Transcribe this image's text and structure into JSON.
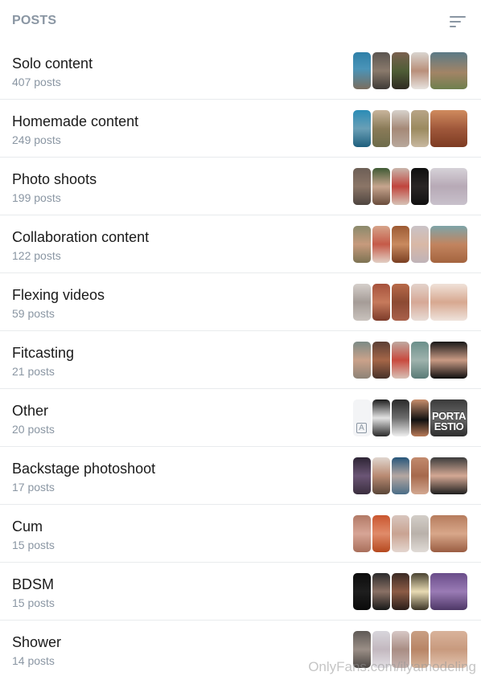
{
  "header": {
    "title": "POSTS",
    "sort_icon": "sort-lines-icon"
  },
  "categories": [
    {
      "name": "Solo content",
      "count": "407 posts",
      "thumbs": [
        {
          "bg": "linear-gradient(180deg,#2e7fa8 0%,#4b94b8 45%,#7a6d5e 100%)"
        },
        {
          "bg": "linear-gradient(180deg,#5b5550 0%,#8a7a6c 50%,#3e3a36 100%)"
        },
        {
          "bg": "linear-gradient(180deg,#7a6150 0%,#4f5d36 50%,#2f2b22 100%)"
        },
        {
          "bg": "linear-gradient(180deg,#d9d4cf 0%,#b98f7a 50%,#e7e3df 100%)"
        },
        {
          "bg": "linear-gradient(180deg,#5b7a86 0%,#a28466 55%,#6e7f4d 100%)"
        }
      ]
    },
    {
      "name": "Homemade content",
      "count": "249 posts",
      "thumbs": [
        {
          "bg": "linear-gradient(180deg,#2b8cb6 0%,#6a9fb6 50%,#1e5f7d 100%)"
        },
        {
          "bg": "linear-gradient(180deg,#c9b59c 0%,#8a7b58 50%,#6d6b4a 100%)"
        },
        {
          "bg": "linear-gradient(180deg,#d7d2cc 0%,#a58977 50%,#b8a89c 100%)"
        },
        {
          "bg": "linear-gradient(180deg,#b8a587 0%,#9b8a5f 50%,#c8b8a0 100%)"
        },
        {
          "bg": "linear-gradient(180deg,#d08b5e 0%,#a0583b 50%,#7d3b22 100%)"
        }
      ]
    },
    {
      "name": "Photo shoots",
      "count": "199 posts",
      "thumbs": [
        {
          "bg": "linear-gradient(180deg,#6d5f56 0%,#8b7567 50%,#4e4540 100%)"
        },
        {
          "bg": "linear-gradient(180deg,#3f5a34 0%,#c7a58e 50%,#6a4d3c 100%)"
        },
        {
          "bg": "linear-gradient(180deg,#c9b5ab 0%,#c0453d 50%,#d6c2b6 100%)"
        },
        {
          "bg": "linear-gradient(180deg,#0f0f0f 0%,#2a2625 50%,#111111 100%)"
        },
        {
          "bg": "linear-gradient(180deg,#d6d2d8 0%,#b7a9b6 50%,#c8c1cb 100%)"
        }
      ]
    },
    {
      "name": "Collaboration content",
      "count": "122 posts",
      "thumbs": [
        {
          "bg": "linear-gradient(180deg,#8b8a6c 0%,#c79a7c 50%,#7d7353 100%)"
        },
        {
          "bg": "linear-gradient(180deg,#d6a48a 0%,#c55a48 50%,#e2cfc4 100%)"
        },
        {
          "bg": "linear-gradient(180deg,#9c5a33 0%,#c98a5f 50%,#7a3f22 100%)"
        },
        {
          "bg": "linear-gradient(180deg,#c9c3c7 0%,#d9b8a6 50%,#bfb3b8 100%)"
        },
        {
          "bg": "linear-gradient(180deg,#7ea4a8 0%,#c2845f 50%,#a4643f 100%)"
        }
      ]
    },
    {
      "name": "Flexing videos",
      "count": "59 posts",
      "thumbs": [
        {
          "bg": "linear-gradient(180deg,#d5cfcb 0%,#a59c97 50%,#c9c2bd 100%)"
        },
        {
          "bg": "linear-gradient(180deg,#a6523c 0%,#c67a5c 50%,#7c3b2a 100%)"
        },
        {
          "bg": "linear-gradient(180deg,#b86a4a 0%,#8c4a33 50%,#a9604a 100%)"
        },
        {
          "bg": "linear-gradient(180deg,#e3d3cb 0%,#d6a896 50%,#e8dcd6 100%)"
        },
        {
          "bg": "linear-gradient(180deg,#f0e2d9 0%,#d7a890 50%,#efe3dc 100%)"
        }
      ]
    },
    {
      "name": "Fitcasting",
      "count": "21 posts",
      "thumbs": [
        {
          "bg": "linear-gradient(180deg,#7c8a86 0%,#caa28a 50%,#8d8276 100%)"
        },
        {
          "bg": "linear-gradient(180deg,#5b3f35 0%,#a56648 50%,#473129 100%)"
        },
        {
          "bg": "linear-gradient(180deg,#bfa9a0 0%,#c84a3e 50%,#d8c1b6 100%)"
        },
        {
          "bg": "linear-gradient(180deg,#6b8f8a 0%,#9fb3ad 50%,#597a76 100%)"
        },
        {
          "bg": "linear-gradient(180deg,#181818 0%,#c99a84 50%,#0f0f0f 100%)"
        }
      ]
    },
    {
      "name": "Other",
      "count": "20 posts",
      "thumbs": [
        {
          "bg": "#f3f4f6",
          "glyph": "A"
        },
        {
          "bg": "linear-gradient(180deg,#1c1c1c 0%,#e3e3e3 50%,#2a2a2a 100%)"
        },
        {
          "bg": "linear-gradient(180deg,#2a2a2a 0%,#6c6c6c 50%,#f0f0f0 100%)"
        },
        {
          "bg": "linear-gradient(180deg,#c88e6c 0%,#111111 55%,#b87a58 100%)"
        },
        {
          "bg": "linear-gradient(180deg,#3a3a3a 0%,#6a6a6a 50%,#2d2d2d 100%)",
          "text": "PORTA\nESTIO"
        }
      ]
    },
    {
      "name": "Backstage photoshoot",
      "count": "17 posts",
      "thumbs": [
        {
          "bg": "linear-gradient(180deg,#2e2535 0%,#6b5575 50%,#3a2e3e 100%)"
        },
        {
          "bg": "linear-gradient(180deg,#e0d6cf 0%,#b98a72 50%,#5a4638 100%)"
        },
        {
          "bg": "linear-gradient(180deg,#27567a 0%,#b5a7a1 50%,#4b6d87 100%)"
        },
        {
          "bg": "linear-gradient(180deg,#c28a6d 0%,#a6694d 50%,#d3a891 100%)"
        },
        {
          "bg": "linear-gradient(180deg,#3c3c3c 0%,#d4a894 50%,#1f1f1f 100%)"
        }
      ]
    },
    {
      "name": "Cum",
      "count": "15 posts",
      "thumbs": [
        {
          "bg": "linear-gradient(180deg,#b27a66 0%,#d7a596 50%,#a96f5b 100%)"
        },
        {
          "bg": "linear-gradient(180deg,#c9562f 0%,#e08b6a 50%,#b5491f 100%)"
        },
        {
          "bg": "linear-gradient(180deg,#d8c6be 0%,#c9a392 50%,#e4d6cf 100%)"
        },
        {
          "bg": "linear-gradient(180deg,#d3cec8 0%,#b9b1aa 50%,#e0dbd6 100%)"
        },
        {
          "bg": "linear-gradient(180deg,#b67c5d 0%,#d8a78a 50%,#9a5d42 100%)"
        }
      ]
    },
    {
      "name": "BDSM",
      "count": "15 posts",
      "thumbs": [
        {
          "bg": "linear-gradient(180deg,#0c0c0c 0%,#1e1e1e 50%,#0a0a0a 100%)"
        },
        {
          "bg": "linear-gradient(180deg,#2c2c2c 0%,#8a7165 50%,#181818 100%)"
        },
        {
          "bg": "linear-gradient(180deg,#3b2a24 0%,#8c5c46 50%,#2a1d19 100%)"
        },
        {
          "bg": "linear-gradient(180deg,#4a4432 0%,#e8dbb3 50%,#3b3526 100%)"
        },
        {
          "bg": "linear-gradient(180deg,#6a4d8a 0%,#9a7bb5 50%,#4d3766 100%)"
        }
      ]
    },
    {
      "name": "Shower",
      "count": "14 posts",
      "thumbs": [
        {
          "bg": "linear-gradient(180deg,#5f5a56 0%,#9a8e86 50%,#4b4643 100%)"
        },
        {
          "bg": "linear-gradient(180deg,#d8d6dc 0%,#c3b8bf 50%,#e3e1e6 100%)"
        },
        {
          "bg": "linear-gradient(180deg,#d7c8c6 0%,#a98d84 50%,#c6b4b0 100%)"
        },
        {
          "bg": "linear-gradient(180deg,#c9a084 0%,#b88566 50%,#d6b59c 100%)"
        },
        {
          "bg": "linear-gradient(180deg,#d9b39b 0%,#c89a7e 50%,#e2c4b0 100%)"
        }
      ]
    }
  ],
  "watermark": "OnlyFans.com/ilyamodeling",
  "colors": {
    "muted": "#8a96a3",
    "text": "#1a1a1a",
    "divider": "#e8ebed"
  }
}
